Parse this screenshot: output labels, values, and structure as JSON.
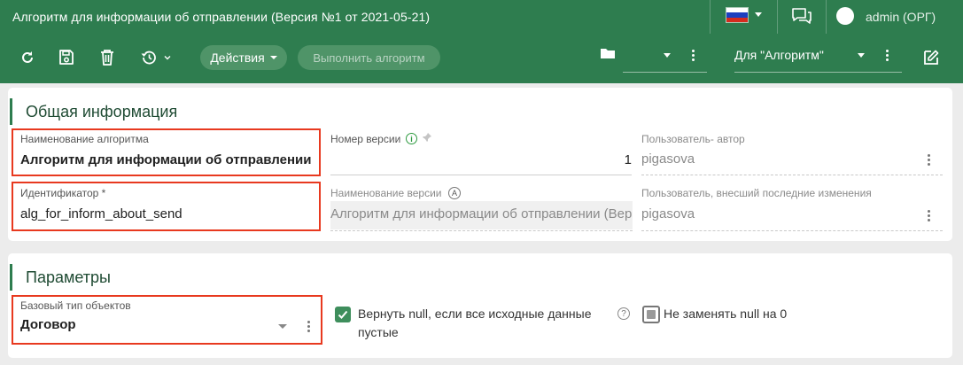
{
  "window": {
    "title": "Алгоритм для информации об отправлении (Версия №1 от 2021-05-21)",
    "user": "admin (ОРГ)",
    "flag_colors": [
      "#ffffff",
      "#1c3fbf",
      "#d52b1e"
    ]
  },
  "toolbar": {
    "refresh_icon": "refresh-icon",
    "save_icon": "save-icon",
    "delete_icon": "trash-icon",
    "history_icon": "history-icon",
    "actions_label": "Действия",
    "run_label": "Выполнить алгоритм",
    "folder_icon": "folder-icon",
    "folder_select_value": "",
    "for_select_value": "Для \"Алгоритм\"",
    "edit_icon": "edit-icon"
  },
  "general": {
    "section_title": "Общая информация",
    "name_label": "Наименование алгоритма",
    "name_value": "Алгоритм для информации об отправлении",
    "id_label": "Идентификатор *",
    "id_value": "alg_for_inform_about_send",
    "version_number_label": "Номер версии",
    "version_number_value": "1",
    "version_name_label": "Наименование версии",
    "version_name_value": "Алгоритм для информации об отправлении (Верс",
    "author_label": "Пользователь- автор",
    "author_value": "pigasova",
    "last_editor_label": "Пользователь, внесший последние изменения",
    "last_editor_value": "pigasova"
  },
  "params": {
    "section_title": "Параметры",
    "base_type_label": "Базовый тип объектов",
    "base_type_value": "Договор",
    "return_null_label": "Вернуть null, если все исходные данные пустые",
    "return_null_checked": true,
    "no_replace_null_label": "Не заменять null на 0",
    "no_replace_null_state": "indeterminate"
  },
  "colors": {
    "brand_green": "#2e7d4f",
    "highlight_red": "#e8391f"
  }
}
